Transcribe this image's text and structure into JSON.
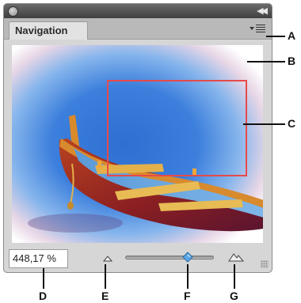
{
  "panel": {
    "tab_label": "Navigation",
    "zoom_value": "448,17 %"
  },
  "icons": {
    "close": "close-icon",
    "collapse": "double-arrow-icon",
    "menu": "panel-menu-icon",
    "zoom_out": "small-mountain-icon",
    "zoom_in": "large-mountain-icon",
    "grip": "resize-grip-icon"
  },
  "zoom": {
    "slider_fraction": 0.74
  },
  "colors": {
    "view_box": "#e64a4a",
    "slider_thumb": "#5aa7e6"
  },
  "callouts": {
    "a": "A",
    "b": "B",
    "c": "C",
    "d": "D",
    "e": "E",
    "f": "F",
    "g": "G"
  }
}
